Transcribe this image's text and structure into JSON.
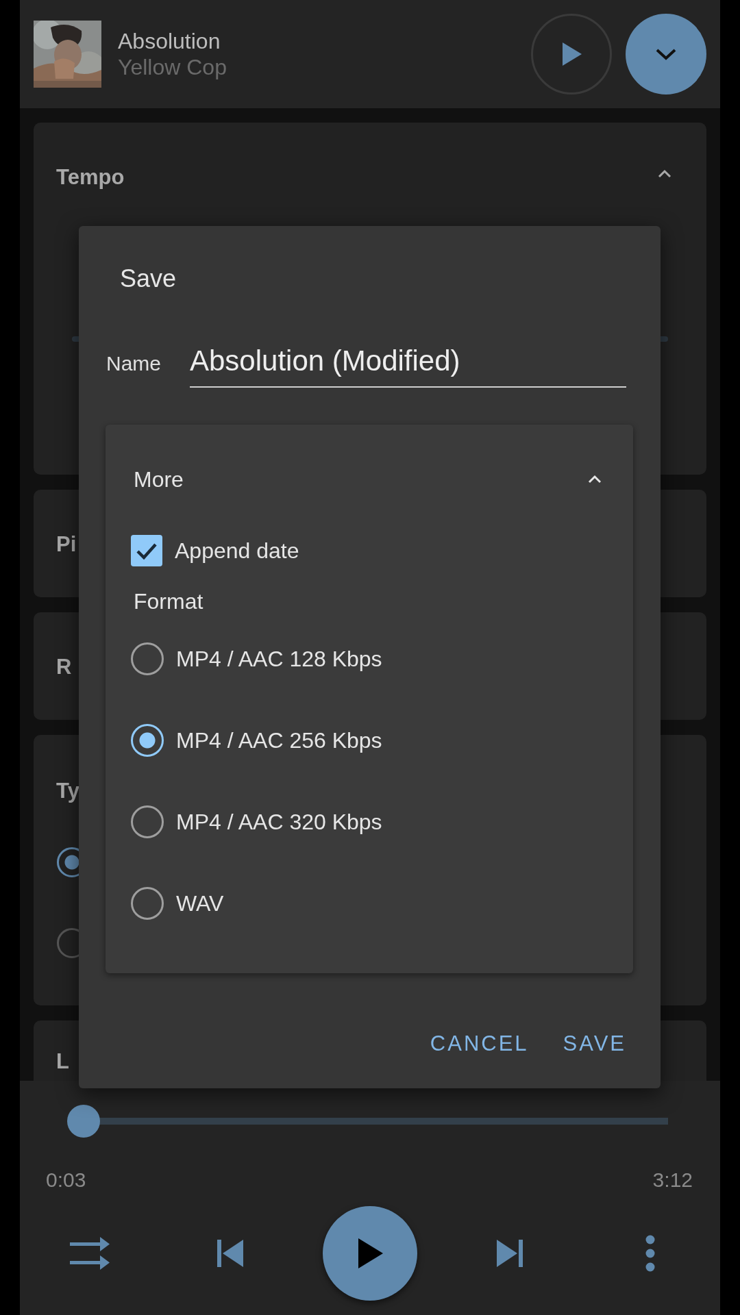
{
  "now_playing": {
    "title": "Absolution",
    "artist": "Yellow Cop"
  },
  "sections": [
    {
      "kind": "slider",
      "title": "Tempo",
      "expanded": true
    },
    {
      "kind": "plain",
      "title": "Pi"
    },
    {
      "kind": "plain",
      "title": "R"
    },
    {
      "kind": "options",
      "title": "Ty",
      "options": [
        {
          "selected": true
        },
        {
          "selected": false
        }
      ]
    },
    {
      "kind": "last",
      "title": "L"
    }
  ],
  "dialog": {
    "title": "Save",
    "name_label": "Name",
    "name_value": "Absolution (Modified)",
    "more": {
      "title": "More",
      "expanded": true,
      "append_date": {
        "label": "Append date",
        "checked": true
      },
      "format_label": "Format",
      "formats": [
        {
          "label": "MP4 / AAC 128 Kbps",
          "selected": false
        },
        {
          "label": "MP4 / AAC 256 Kbps",
          "selected": true
        },
        {
          "label": "MP4 / AAC 320 Kbps",
          "selected": false
        },
        {
          "label": "WAV",
          "selected": false
        }
      ]
    },
    "buttons": [
      "CANCEL",
      "SAVE"
    ]
  },
  "player": {
    "level": 0.0,
    "elapsed": "0:03",
    "duration": "3:12"
  }
}
